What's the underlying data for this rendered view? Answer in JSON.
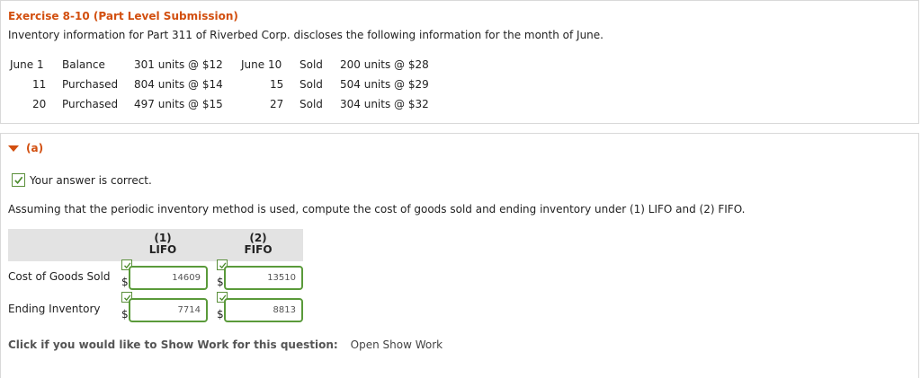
{
  "exercise": {
    "title": "Exercise 8-10 (Part Level Submission)",
    "description": "Inventory information for Part 311 of Riverbed Corp. discloses the following information for the month of June."
  },
  "inventory": [
    {
      "date": "June 1",
      "type": "Balance",
      "detail": "301 units @ $12",
      "date2": "June 10",
      "type2": "Sold",
      "detail2": "200 units @ $28"
    },
    {
      "date": "11",
      "type": "Purchased",
      "detail": "804 units @ $14",
      "date2": "15",
      "type2": "Sold",
      "detail2": "504 units @ $29"
    },
    {
      "date": "20",
      "type": "Purchased",
      "detail": "497 units @ $15",
      "date2": "27",
      "type2": "Sold",
      "detail2": "304 units @ $32"
    }
  ],
  "part": {
    "label": "(a)",
    "status": "Your answer is correct.",
    "question": "Assuming that the periodic inventory method is used, compute the cost of goods sold and ending inventory under (1) LIFO and (2) FIFO."
  },
  "table": {
    "col1_num": "(1)",
    "col1_name": "LIFO",
    "col2_num": "(2)",
    "col2_name": "FIFO",
    "rows": [
      {
        "label": "Cost of Goods Sold",
        "currency": "$",
        "lifo": "14609",
        "fifo": "13510"
      },
      {
        "label": "Ending Inventory",
        "currency": "$",
        "lifo": "7714",
        "fifo": "8813"
      }
    ]
  },
  "show_work": {
    "label": "Click if you would like to Show Work for this question:",
    "link": "Open Show Work"
  },
  "colors": {
    "accent": "#d24f0f",
    "correct_green": "#5a9a3a"
  }
}
